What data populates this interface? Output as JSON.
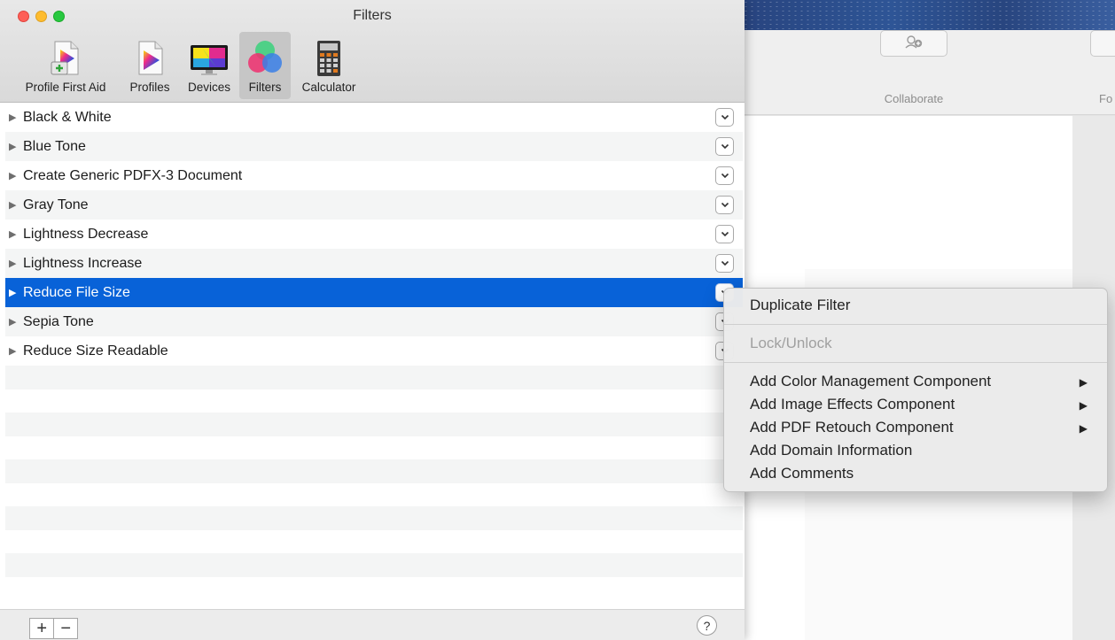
{
  "window": {
    "title": "Filters",
    "toolbar": [
      {
        "label": "Profile First Aid",
        "icon": "profile-first-aid-icon"
      },
      {
        "label": "Profiles",
        "icon": "profiles-icon"
      },
      {
        "label": "Devices",
        "icon": "devices-icon"
      },
      {
        "label": "Filters",
        "icon": "filters-icon",
        "selected": true
      },
      {
        "label": "Calculator",
        "icon": "calculator-icon"
      }
    ]
  },
  "filters": [
    {
      "label": "Black & White"
    },
    {
      "label": "Blue Tone"
    },
    {
      "label": "Create Generic PDFX-3 Document"
    },
    {
      "label": "Gray Tone"
    },
    {
      "label": "Lightness Decrease"
    },
    {
      "label": "Lightness Increase"
    },
    {
      "label": "Reduce File Size",
      "selected": true
    },
    {
      "label": "Sepia Tone"
    },
    {
      "label": "Reduce Size Readable"
    }
  ],
  "bottom": {
    "add": "+",
    "remove": "−",
    "help": "?"
  },
  "context_menu": {
    "items": [
      {
        "label": "Duplicate Filter"
      },
      {
        "label": "Lock/Unlock",
        "disabled": true
      },
      {
        "label": "Add Color Management Component",
        "submenu": true
      },
      {
        "label": "Add Image Effects Component",
        "submenu": true
      },
      {
        "label": "Add PDF Retouch Component",
        "submenu": true
      },
      {
        "label": "Add Domain Information"
      },
      {
        "label": "Add Comments"
      }
    ]
  },
  "background_app": {
    "collaborate_label": "Collaborate",
    "partial_label": "Fo"
  },
  "colors": {
    "selection": "#0862d8",
    "accent_close": "#fe5f57",
    "accent_min": "#febc2e",
    "accent_max": "#28c840"
  }
}
